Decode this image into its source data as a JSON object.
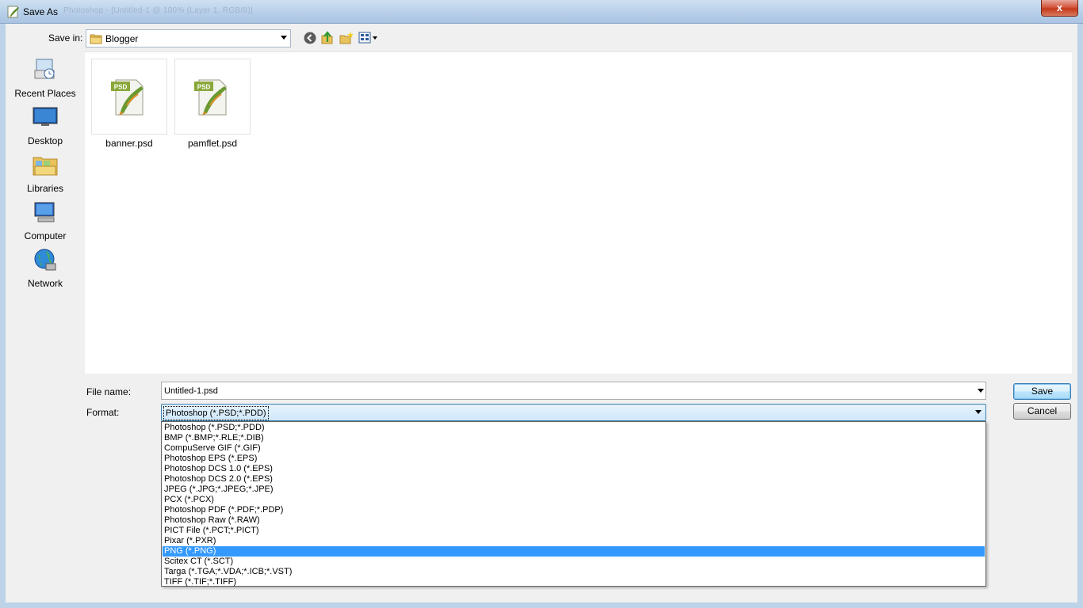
{
  "window": {
    "title": "Save As",
    "ghost_title": "Photoshop - [Untitled-1 @ 100% (Layer 1, RGB/8)]",
    "close_label": "x"
  },
  "toolbar": {
    "save_in_label": "Save in:",
    "save_in_value": "Blogger"
  },
  "places": [
    {
      "label": "Recent Places",
      "icon": "recent-places-icon"
    },
    {
      "label": "Desktop",
      "icon": "desktop-icon"
    },
    {
      "label": "Libraries",
      "icon": "libraries-icon"
    },
    {
      "label": "Computer",
      "icon": "computer-icon"
    },
    {
      "label": "Network",
      "icon": "network-icon"
    }
  ],
  "files": [
    {
      "name": "banner.psd",
      "badge": "PSD"
    },
    {
      "name": "pamflet.psd",
      "badge": "PSD"
    }
  ],
  "form": {
    "file_name_label": "File name:",
    "file_name_value": "Untitled-1.psd",
    "format_label": "Format:",
    "format_value": "Photoshop (*.PSD;*.PDD)"
  },
  "buttons": {
    "save": "Save",
    "cancel": "Cancel"
  },
  "format_options": [
    "Photoshop (*.PSD;*.PDD)",
    "BMP (*.BMP;*.RLE;*.DIB)",
    "CompuServe GIF (*.GIF)",
    "Photoshop EPS (*.EPS)",
    "Photoshop DCS 1.0 (*.EPS)",
    "Photoshop DCS 2.0 (*.EPS)",
    "JPEG (*.JPG;*.JPEG;*.JPE)",
    "PCX (*.PCX)",
    "Photoshop PDF (*.PDF;*.PDP)",
    "Photoshop Raw (*.RAW)",
    "PICT File (*.PCT;*.PICT)",
    "Pixar (*.PXR)",
    "PNG (*.PNG)",
    "Scitex CT (*.SCT)",
    "Targa (*.TGA;*.VDA;*.ICB;*.VST)",
    "TIFF (*.TIF;*.TIFF)"
  ],
  "selected_format_index": 12,
  "colors": {
    "selection": "#3399ff",
    "close": "#c4381b"
  }
}
